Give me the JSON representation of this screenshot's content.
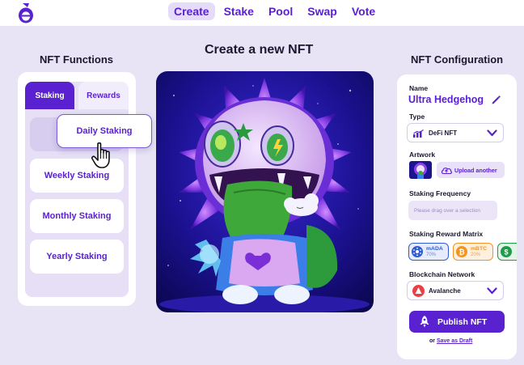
{
  "nav": {
    "items": [
      "Create",
      "Stake",
      "Pool",
      "Swap",
      "Vote"
    ],
    "active": "Create"
  },
  "functions": {
    "title": "NFT Functions",
    "tabs": [
      "Staking",
      "Rewards"
    ],
    "dragging": "Daily Staking",
    "options": [
      "Weekly Staking",
      "Monthly Staking",
      "Yearly Staking"
    ]
  },
  "main": {
    "title": "Create a new NFT"
  },
  "config": {
    "title": "NFT Configuration",
    "name_label": "Name",
    "name_value": "Ultra Hedgehog",
    "type_label": "Type",
    "type_value": "DeFi NFT",
    "artwork_label": "Artwork",
    "upload_label": "Upload another",
    "frequency_label": "Staking Frequency",
    "frequency_placeholder": "Please drag over a selection",
    "matrix_label": "Staking Reward Matrix",
    "tokens": [
      {
        "symbol": "mADA",
        "pct": "70%"
      },
      {
        "symbol": "mBTC",
        "pct": "20%"
      },
      {
        "symbol": "",
        "pct": ""
      }
    ],
    "network_label": "Blockchain Network",
    "network_value": "Avalanche",
    "publish_label": "Publish NFT",
    "draft_prefix": "or",
    "draft_link": "Save as Draft"
  },
  "colors": {
    "accent": "#5a21d1",
    "background": "#e9e4f5",
    "ada": "#2f5bd6",
    "btc": "#f2941f",
    "usd": "#1e9c4a",
    "avalanche": "#e84142"
  },
  "icons": [
    "logo-icon",
    "hand-cursor-icon",
    "pencil-icon",
    "chart-icon",
    "chevron-down-icon",
    "cloud-upload-icon",
    "ada-coin-icon",
    "btc-coin-icon",
    "dollar-coin-icon",
    "avalanche-icon",
    "rocket-icon"
  ]
}
